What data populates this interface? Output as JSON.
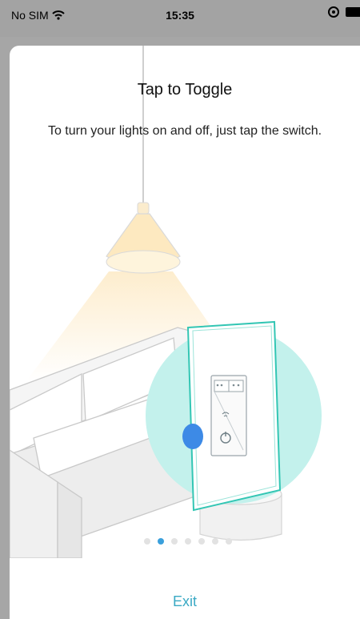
{
  "status_bar": {
    "carrier": "No SIM",
    "time": "15:35"
  },
  "page": {
    "title": "Tap to Toggle",
    "subtitle": "To turn your lights on and off, just tap the switch."
  },
  "pager": {
    "count": 7,
    "active_index": 1
  },
  "exit_label": "Exit",
  "colors": {
    "accent": "#3aa9c4",
    "active_dot": "#3aa0dc",
    "highlight_circle": "#c3f1ec",
    "switch_edge": "#33c6b4",
    "touch_dot": "#3d8ae6",
    "lamp_glow": "#fdeccb"
  }
}
